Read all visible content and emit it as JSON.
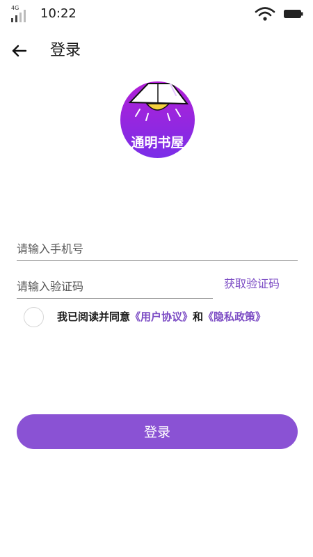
{
  "status_bar": {
    "network": "4G",
    "time": "10:22",
    "icons": [
      "signal-icon",
      "wifi-icon",
      "battery-icon"
    ]
  },
  "header": {
    "back_icon": "arrow-left-icon",
    "title": "登录"
  },
  "logo": {
    "text": "通明书屋",
    "colors": {
      "top": "#b21fd6",
      "bottom": "#7a2ee8",
      "lamp": "#f4d03f"
    }
  },
  "form": {
    "phone": {
      "placeholder": "请输入手机号",
      "value": ""
    },
    "code": {
      "placeholder": "请输入验证码",
      "value": ""
    },
    "get_code_label": "获取验证码",
    "agreement": {
      "checked": false,
      "prefix": "我已阅读并同意",
      "user_agreement": "《用户协议》",
      "conjunction": "和",
      "privacy_policy": "《隐私政策》"
    },
    "login_label": "登录"
  },
  "colors": {
    "accent": "#8a52d4",
    "link": "#7b4bc4",
    "background": "#ffffff"
  }
}
